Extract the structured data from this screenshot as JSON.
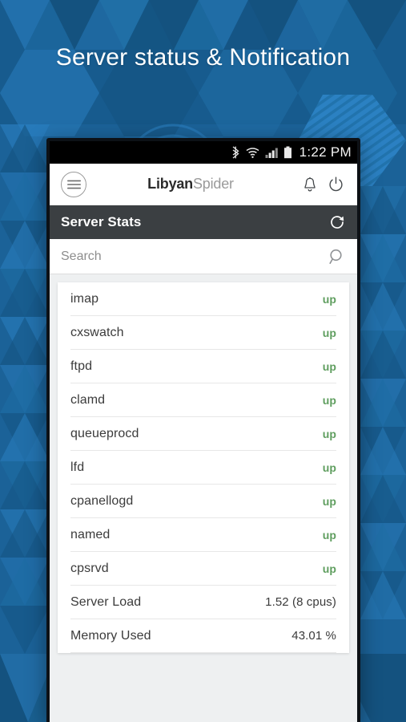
{
  "promo": {
    "title": "Server status & Notification"
  },
  "theme": {
    "bg_blue_dark": "#14527f",
    "bg_blue_mid": "#1b6298",
    "bg_blue_light": "#2c82c4",
    "status_bar": "#000000",
    "section_bar": "#3b3f42",
    "up_green": "#5f9e5f",
    "text_dark": "#3b3b3b"
  },
  "statusbar": {
    "clock": "1:22 PM",
    "icons": [
      "bluetooth-icon",
      "wifi-icon",
      "cellular-signal-icon",
      "battery-icon"
    ]
  },
  "appbar": {
    "menu_icon": "hamburger-menu-icon",
    "brand_primary": "Libyan",
    "brand_secondary": "Spider",
    "notification_icon": "bell-icon",
    "power_icon": "power-icon"
  },
  "section": {
    "title": "Server Stats",
    "refresh_icon": "refresh-icon"
  },
  "search": {
    "placeholder": "Search",
    "value": "",
    "icon": "search-icon"
  },
  "stats": {
    "rows": [
      {
        "label": "imap",
        "value": "up",
        "type": "status"
      },
      {
        "label": "cxswatch",
        "value": "up",
        "type": "status"
      },
      {
        "label": "ftpd",
        "value": "up",
        "type": "status"
      },
      {
        "label": "clamd",
        "value": "up",
        "type": "status"
      },
      {
        "label": "queueprocd",
        "value": "up",
        "type": "status"
      },
      {
        "label": "lfd",
        "value": "up",
        "type": "status"
      },
      {
        "label": "cpanellogd",
        "value": "up",
        "type": "status"
      },
      {
        "label": "named",
        "value": "up",
        "type": "status"
      },
      {
        "label": "cpsrvd",
        "value": "up",
        "type": "status"
      },
      {
        "label": "Server Load",
        "value": "1.52 (8 cpus)",
        "type": "metric"
      },
      {
        "label": "Memory Used",
        "value": "43.01 %",
        "type": "metric"
      }
    ]
  }
}
